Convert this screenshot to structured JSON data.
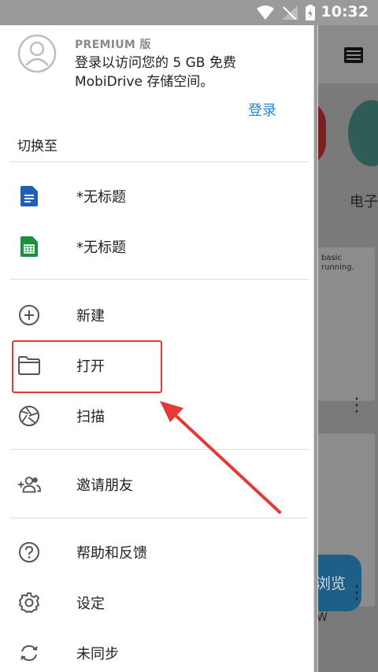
{
  "status_bar": {
    "time": "10:32",
    "icons": [
      "wifi-icon",
      "signal-icon",
      "battery-charging-icon"
    ]
  },
  "account": {
    "tier": "PREMIUM 版",
    "description": "登录以访问您的 5 GB 免费 MobiDrive 存储空间。",
    "login_label": "登录"
  },
  "switch_label": "切换至",
  "recent_files": [
    {
      "icon": "document-icon",
      "label": "*无标题",
      "color": "#1f5fb8"
    },
    {
      "icon": "spreadsheet-icon",
      "label": "*无标题",
      "color": "#1e8e3e"
    }
  ],
  "actions": [
    {
      "icon": "add-circle-icon",
      "label": "新建"
    },
    {
      "icon": "folder-icon",
      "label": "打开"
    },
    {
      "icon": "camera-shutter-icon",
      "label": "扫描"
    }
  ],
  "social": [
    {
      "icon": "invite-people-icon",
      "label": "邀请朋友"
    }
  ],
  "settings_menu": [
    {
      "icon": "help-icon",
      "label": "帮助和反馈"
    },
    {
      "icon": "gear-icon",
      "label": "设定"
    },
    {
      "icon": "sync-icon",
      "label": "未同步"
    }
  ],
  "background": {
    "category_label": "电子",
    "card1_text": [
      "basic",
      "running."
    ],
    "fab_label": "浏览",
    "card2_suffix": "W",
    "accent": "#1e5f88"
  },
  "annotation_color": "#e53935"
}
